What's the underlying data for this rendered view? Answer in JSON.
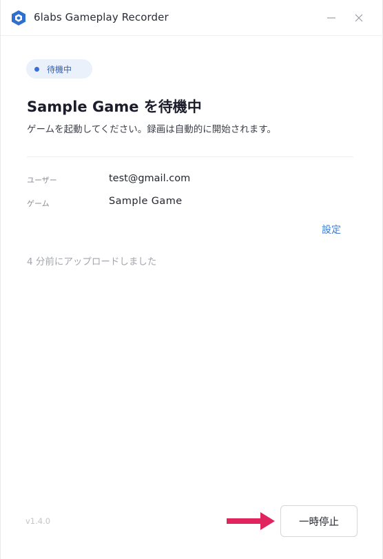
{
  "window": {
    "title": "6labs Gameplay Recorder",
    "controls": {
      "minimize_icon": "minimize-icon",
      "close_icon": "close-icon"
    }
  },
  "status": {
    "label": "待機中",
    "dot_color": "#3a6fd8",
    "pill_color": "#eaf1fb"
  },
  "heading": "Sample Game を待機中",
  "subtext": "ゲームを起動してください。録画は自動的に開始されます。",
  "info": {
    "user_label": "ユーザー",
    "user_value": "test@gmail.com",
    "game_label": "ゲーム",
    "game_value": "Sample Game"
  },
  "settings_label": "設定",
  "upload_status": "4 分前にアップロードしました",
  "footer": {
    "version": "v1.4.0",
    "pause_label": "一時停止",
    "arrow_color": "#e0245e",
    "accent_color": "#3d7bd6"
  }
}
